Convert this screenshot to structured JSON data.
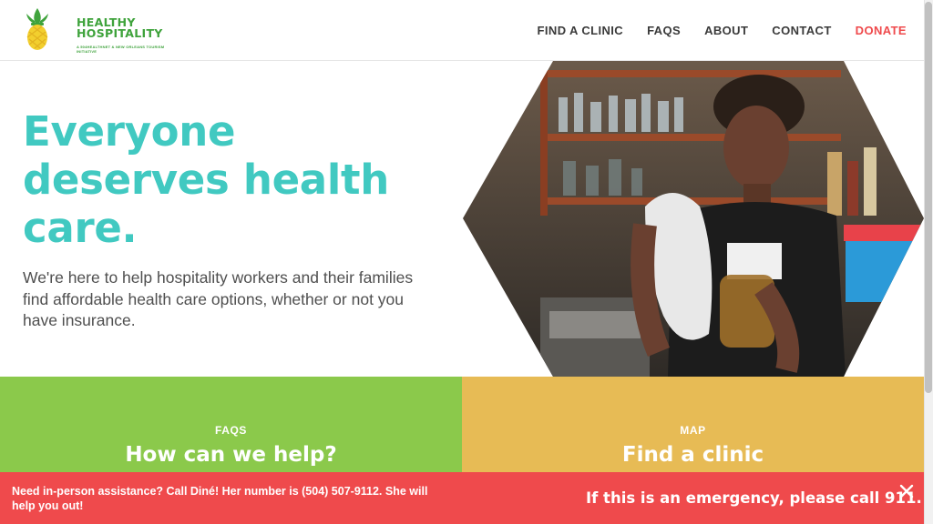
{
  "logo": {
    "line1": "HEALTHY",
    "line2": "HOSPITALITY",
    "subtitle": "A 504HEALTHNET & NEW ORLEANS TOURISM INITIATIVE",
    "icon": "pineapple-icon"
  },
  "nav": {
    "items": [
      "FIND A CLINIC",
      "FAQS",
      "ABOUT",
      "CONTACT"
    ],
    "donate": "DONATE"
  },
  "hero": {
    "title": "Everyone deserves health care.",
    "text": "We're here to help hospitality workers and their families find affordable health care options, whether or not you have insurance.",
    "image": "bartender-hexagon-photo"
  },
  "cards": [
    {
      "eyebrow": "FAQS",
      "title": "How can we help?"
    },
    {
      "eyebrow": "MAP",
      "title": "Find a clinic"
    }
  ],
  "alert": {
    "assist": "Need in-person assistance? Call Diné! Her number is (504) 507-9112. She will help you out!",
    "emergency": "If this is an emergency, please call 911.",
    "close_icon": "close-icon"
  },
  "colors": {
    "teal": "#41c9c1",
    "green": "#8bc94b",
    "gold": "#e7bb55",
    "red": "#ef4a4c"
  }
}
